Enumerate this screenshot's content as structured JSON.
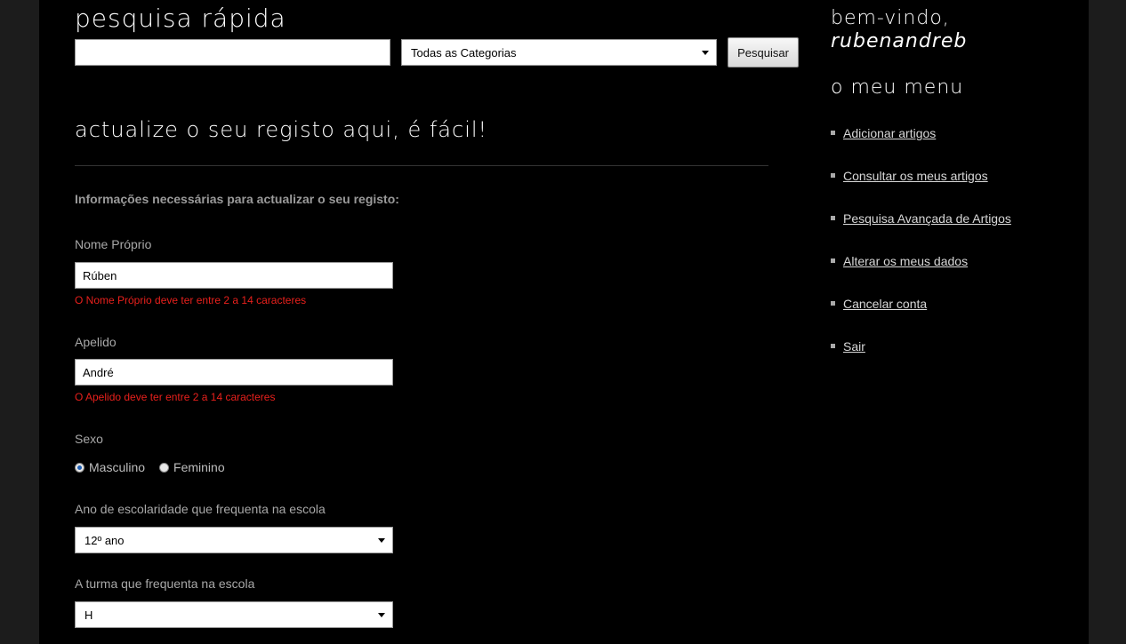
{
  "search": {
    "title": "pesquisa rápida",
    "input_value": "",
    "category_selected": "Todas as Categorias",
    "button_label": "Pesquisar"
  },
  "form": {
    "section_title": "actualize o seu registo aqui, é fácil!",
    "info_text": "Informações necessárias para actualizar o seu registo:",
    "first_name": {
      "label": "Nome Próprio",
      "value": "Rúben",
      "error": "O Nome Próprio deve ter entre 2 a 14 caracteres"
    },
    "last_name": {
      "label": "Apelido",
      "value": "André",
      "error": "O Apelido deve ter entre 2 a 14 caracteres"
    },
    "gender": {
      "label": "Sexo",
      "options": [
        "Masculino",
        "Feminino"
      ],
      "selected": "Masculino"
    },
    "school_year": {
      "label": "Ano de escolaridade que frequenta na escola",
      "selected": "12º ano"
    },
    "class": {
      "label": "A turma que frequenta na escola",
      "selected": "H"
    }
  },
  "sidebar": {
    "greeting": "bem-vindo,",
    "username": "rubenandreb",
    "menu_title": "o meu menu",
    "items": [
      {
        "label": "Adicionar artigos"
      },
      {
        "label": "Consultar os meus artigos"
      },
      {
        "label": "Pesquisa Avançada de Artigos"
      },
      {
        "label": "Alterar os meus dados"
      },
      {
        "label": "Cancelar conta"
      },
      {
        "label": "Sair"
      }
    ]
  },
  "colors": {
    "background": "#000000",
    "outer": "#1c1c1c",
    "error": "#e8201c",
    "radio_selected": "#1f5fb5"
  }
}
